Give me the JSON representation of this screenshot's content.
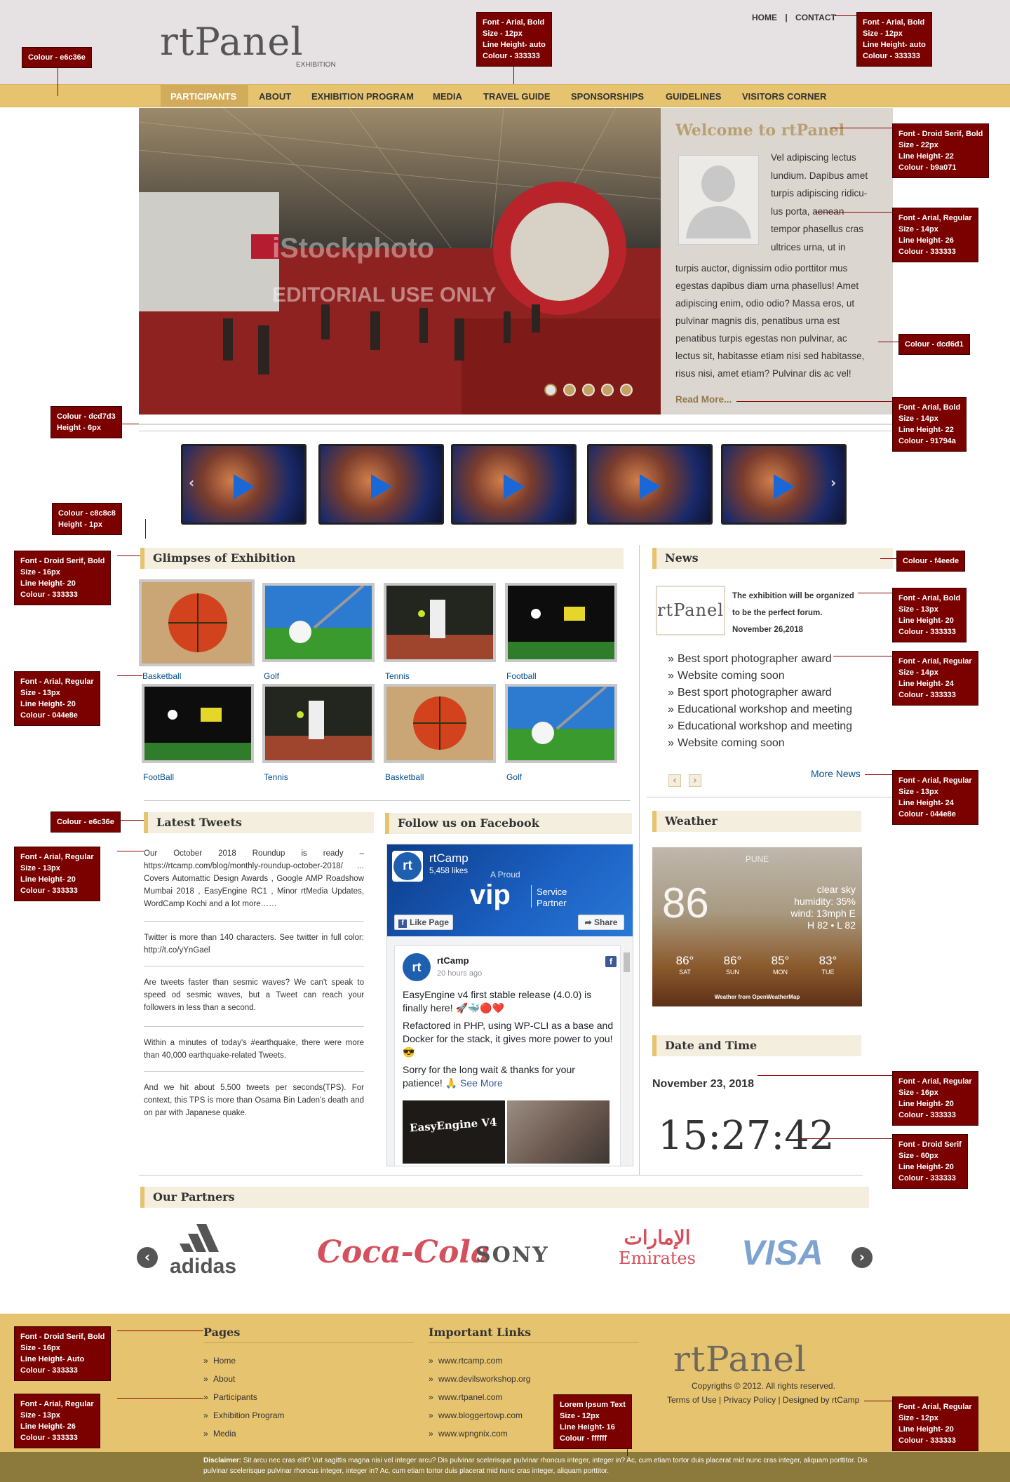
{
  "header": {
    "logo": "rtPanel",
    "logo_sub": "EXHIBITION",
    "top_links": [
      "HOME",
      "CONTACT"
    ],
    "top_sep": "|"
  },
  "nav": {
    "items": [
      "PARTICIPANTS",
      "ABOUT",
      "EXHIBITION PROGRAM",
      "MEDIA",
      "TRAVEL GUIDE",
      "SPONSORSHIPS",
      "GUIDELINES",
      "VISITORS CORNER"
    ]
  },
  "hero": {
    "watermark1": "iStockphoto",
    "watermark2": "EDITORIAL USE ONLY",
    "dots": 5
  },
  "welcome": {
    "title": "Welcome to rtPanel",
    "side_lines": [
      "Vel adipiscing lectus",
      "lundium. Dapibus amet",
      "turpis adipiscing ridicu-",
      "lus porta, aenean",
      "tempor phasellus cras",
      "ultrices urna, ut in"
    ],
    "body_lines": [
      "turpis auctor, dignissim odio porttitor mus",
      "egestas dapibus diam urna phasellus! Amet",
      "adipiscing enim, odio odio? Massa eros, ut",
      "pulvinar magnis dis, penatibus urna est",
      "penatibus turpis egestas non pulvinar, ac",
      "lectus sit, habitasse etiam nisi sed habitasse,",
      "risus nisi, amet etiam? Pulvinar dis ac vel!"
    ],
    "read_more": "Read More..."
  },
  "glimpses": {
    "heading": "Glimpses of Exhibition",
    "items": [
      "Basketball",
      "Golf",
      "Tennis",
      "Football",
      "FootBall",
      "Tennis",
      "Basketball",
      "Golf"
    ]
  },
  "news": {
    "heading": "News",
    "logo": "rtPanel",
    "featured_line1": "The exhibition will be organized",
    "featured_line2": "to be the perfect forum.",
    "featured_date": "November 26,2018",
    "items": [
      "Best sport photographer award",
      "Website coming soon",
      "Best sport photographer award",
      "Educational workshop and meeting",
      "Educational workshop and meeting",
      "Website coming soon"
    ],
    "more": "More News"
  },
  "tweets": {
    "heading": "Latest Tweets",
    "items": [
      "Our October 2018 Roundup is ready – https://rtcamp.com/blog/monthly-roundup-october-2018/ ... Covers Automattic Design Awards , Google AMP Roadshow Mumbai 2018 , EasyEngine RC1 , Minor rtMedia Updates, WordCamp Kochi and a lot more……",
      "Twitter is more than 140 characters. See twitter in full color: http://t.co/yYnGael",
      "Are tweets faster than sesmic waves? We can't speak to speed od sesmic waves, but a Tweet can reach your followers in less than a second.",
      "Within a minutes of today's #earthquake, there were more than 40,000 earthquake-related Tweets.",
      "And we hit about 5,500 tweets per seconds(TPS). For context, this TPS is more than Osama Bin Laden's death and on par with Japanese quake."
    ]
  },
  "facebook": {
    "heading": "Follow us on Facebook",
    "page_name": "rtCamp",
    "likes": "5,458 likes",
    "cover_line1": "A Proud",
    "cover_big": "vip",
    "cover_line2": "Service",
    "cover_line3": "Partner",
    "like_btn": "Like Page",
    "share_btn": "Share",
    "post_name": "rtCamp",
    "post_time": "20 hours ago",
    "post_p1": "EasyEngine v4 first stable release (4.0.0) is finally here! 🚀🐳🔴❤️",
    "post_p2": "Refactored in PHP, using WP-CLI as a base and Docker for the stack, it gives more power to you! 😎",
    "post_p3": "Sorry for the long wait & thanks for your patience! 🙏",
    "see_more": "See More",
    "img_text": "EasyEngine V4"
  },
  "weather": {
    "heading": "Weather",
    "city": "PUNE",
    "temp": "86",
    "cond": "clear sky",
    "humidity": "humidity: 35%",
    "wind": "wind: 13mph E",
    "hilo": "H 82 • L 82",
    "days": [
      {
        "t": "86°",
        "d": "SAT"
      },
      {
        "t": "86°",
        "d": "SUN"
      },
      {
        "t": "85°",
        "d": "MON"
      },
      {
        "t": "83°",
        "d": "TUE"
      }
    ],
    "credit": "Weather from OpenWeatherMap"
  },
  "datetime": {
    "heading": "Date and Time",
    "date": "November 23, 2018",
    "time": "15:27:42"
  },
  "partners": {
    "heading": "Our Partners",
    "items": [
      "adidas",
      "Coca-Cola",
      "SONY",
      "Emirates",
      "VISA"
    ]
  },
  "footer": {
    "pages_heading": "Pages",
    "pages": [
      "Home",
      "About",
      "Participants",
      "Exhibition Program",
      "Media"
    ],
    "links_heading": "Important Links",
    "links": [
      "www.rtcamp.com",
      "www.devilsworkshop.org",
      "www.rtpanel.com",
      "www.bloggertowp.com",
      "www.wpngnix.com"
    ],
    "logo": "rtPanel",
    "copyright": "Copyrigths © 2012. All rights reserved.",
    "terms": "Terms of Use | Privacy Policy | Designed by rtCamp",
    "disclaimer_label": "Disclaimer:",
    "disclaimer": "Sit arcu nec cras elit? Vut sagittis magna nisi vel integer arcu? Dis pulvinar scelerisque pulvinar rhoncus integer, integer in? Ac, cum etiam tortor duis placerat mid nunc cras integer, aliquam porttitor. Dis pulvinar scelerisque pulvinar rhoncus integer, integer in? Ac, cum etiam tortor duis placerat mid nunc cras integer, aliquam porttitor."
  },
  "notes": {
    "n_bg": "Colour - e6c36e",
    "n_toplink": "Font - Arial, Bold\nSize - 12px\nLine Height- auto\nColour - 333333",
    "n_topright": "Font - Arial, Bold\nSize - 12px\nLine Height- auto\nColour - 333333",
    "n_welcome": "Font - Droid Serif, Bold\nSize - 22px\nLine Height- 22\nColour - b9a071",
    "n_body": "Font - Arial, Regular\nSize - 14px\nLine Height- 26\nColour - 333333",
    "n_panel": "Colour - dcd6d1",
    "n_readmore": "Font - Arial, Bold\nSize - 14px\nLine Height- 22\nColour - 91794a",
    "n_rule": "Colour - dcd7d3\nHeight - 6px",
    "n_hr": "Colour - c8c8c8\nHeight - 1px",
    "n_sechead": "Font - Droid Serif, Bold\nSize - 16px\nLine Height- 20\nColour - 333333",
    "n_secbg": "Colour - f4eede",
    "n_newsbold": "Font - Arial, Bold\nSize - 13px\nLine Height- 20\nColour - 333333",
    "n_thumblink": "Font - Arial, Regular\nSize - 13px\nLine Height- 20\nColour - 044e8e",
    "n_newslist": "Font - Arial, Regular\nSize - 14px\nLine Height- 24\nColour - 333333",
    "n_morenews": "Font - Arial, Regular\nSize - 13px\nLine Height- 24\nColour - 044e8e",
    "n_border": "Colour - e6c36e",
    "n_tweet": "Font - Arial, Regular\nSize - 13px\nLine Height- 20\nColour - 333333",
    "n_date": "Font - Arial, Regular\nSize - 16px\nLine Height- 20\nColour - 333333",
    "n_clock": "Font - Droid Serif\nSize - 60px\nLine Height- 20\nColour - 333333",
    "n_fhead": "Font - Droid Serif, Bold\nSize - 16px\nLine Height- Auto\nColour - 333333",
    "n_flink": "Font - Arial, Regular\nSize - 13px\nLine Height- 26\nColour - 333333",
    "n_lorem": "Lorem Ipsum Text\nSize - 12px\nLine Height- 16\nColour - ffffff",
    "n_fright": "Font - Arial, Regular\nSize - 12px\nLine Height- 20\nColour - 333333"
  }
}
